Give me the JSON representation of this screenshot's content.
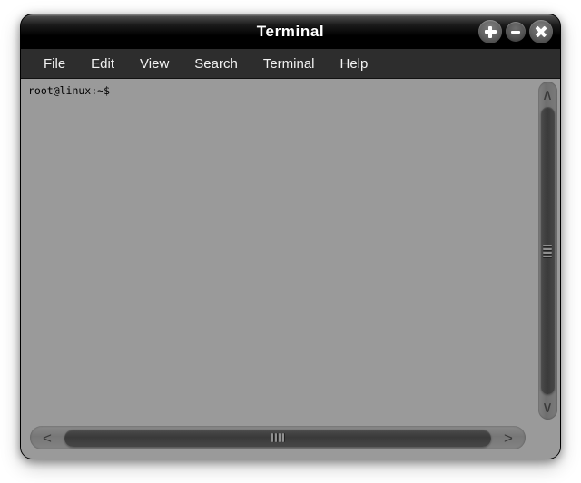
{
  "window": {
    "title": "Terminal",
    "controls": [
      {
        "name": "maximize-button",
        "icon": "plus-icon",
        "label": "+"
      },
      {
        "name": "minimize-button",
        "icon": "minus-icon",
        "label": "−"
      },
      {
        "name": "close-button",
        "icon": "close-x-icon",
        "label": "×"
      }
    ]
  },
  "menubar": {
    "items": [
      {
        "label": "File"
      },
      {
        "label": "Edit"
      },
      {
        "label": "View"
      },
      {
        "label": "Search"
      },
      {
        "label": "Terminal"
      },
      {
        "label": "Help"
      }
    ]
  },
  "terminal": {
    "lines": [
      "root@linux:~$"
    ],
    "prompt": "root@linux:~$",
    "background_color": "#9a9a9a",
    "text_color": "#000000"
  },
  "scrollbars": {
    "vertical": {
      "up_arrow": "∧",
      "down_arrow": "∨",
      "grip_lines": 4
    },
    "horizontal": {
      "left_arrow": "<",
      "right_arrow": ">",
      "grip_lines": 4
    }
  },
  "colors": {
    "titlebar": "#000000",
    "menubar": "#2d2d2d",
    "content": "#9a9a9a",
    "menu_text": "#f2f2f2",
    "title_text": "#ffffff",
    "scroll_thumb": "#3a3a3a"
  }
}
